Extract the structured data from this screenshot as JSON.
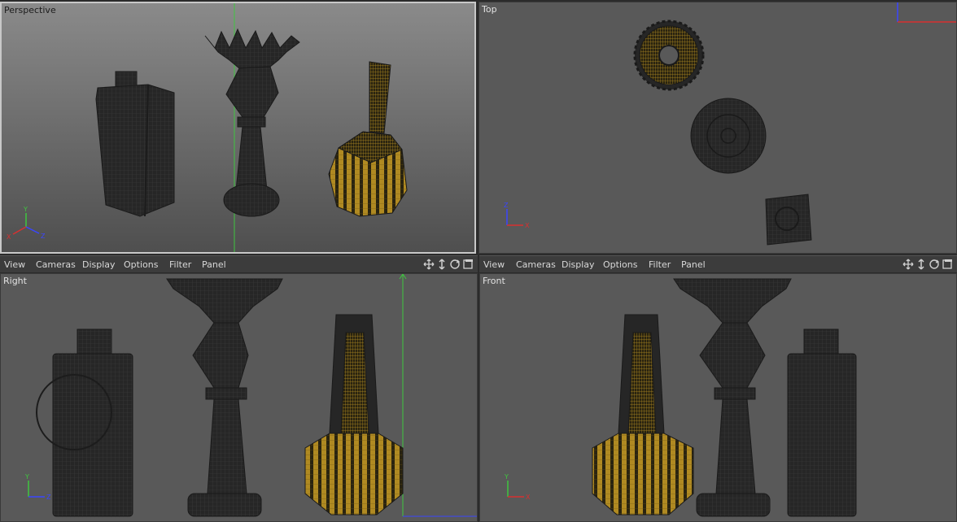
{
  "viewports": {
    "perspective": {
      "label": "Perspective"
    },
    "top": {
      "label": "Top"
    },
    "right": {
      "label": "Right"
    },
    "front": {
      "label": "Front"
    }
  },
  "menus": {
    "left": [
      "View",
      "Cameras",
      "Display",
      "Options",
      "Filter",
      "Panel"
    ],
    "right": [
      "View",
      "Cameras",
      "Display",
      "Options",
      "Filter",
      "Panel"
    ]
  },
  "nav_icons": [
    "move-view-icon",
    "dolly-view-icon",
    "rotate-view-icon",
    "maximize-view-icon"
  ],
  "axis": {
    "x": "X",
    "y": "Y",
    "z": "Z"
  },
  "colors": {
    "viewport_bg": "#595959",
    "wire_dark": "#232323",
    "wire_gold": "#9c7a1c",
    "axis_x": "#d83030",
    "axis_y": "#3fc63f",
    "axis_z": "#3a46ff"
  }
}
